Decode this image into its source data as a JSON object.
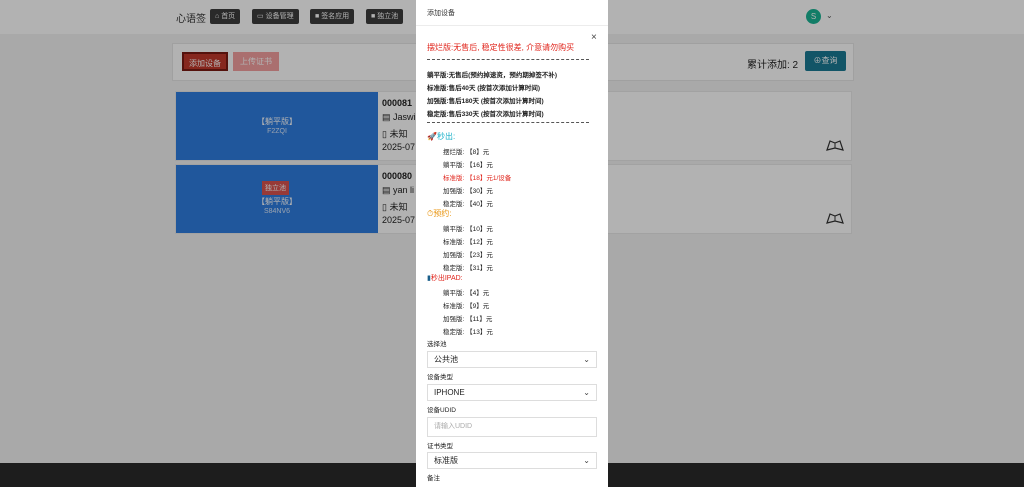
{
  "brand": "心语签",
  "nav": [
    {
      "icon": "⌂",
      "label": "首页"
    },
    {
      "icon": "▭",
      "label": "设备管理"
    },
    {
      "icon": "■",
      "label": "签名应用"
    },
    {
      "icon": "■",
      "label": "独立池"
    }
  ],
  "user": {
    "avatar": "S",
    "caret": "⌄"
  },
  "toolbar": {
    "add_label": "添加设备",
    "upload_label": "上传证书",
    "total_label": "累计添加: 2",
    "query_label": "查询",
    "query_icon": "⊕"
  },
  "cards": [
    {
      "badge": "",
      "edition": "【躺平版】",
      "code": "F2ZQI",
      "id": "000081",
      "name": "Jaswi",
      "status": "未知",
      "date": "2025-07",
      "name_icon": "▤",
      "status_icon": "▯"
    },
    {
      "badge": "独立池",
      "edition": "【躺平版】",
      "code": "S84NV6",
      "id": "000080",
      "name": "yan li",
      "status": "未知",
      "date": "2025-07",
      "name_icon": "▤",
      "status_icon": "▯"
    }
  ],
  "modal": {
    "title": "添加设备",
    "close": "×",
    "warning": "摆烂版:无售后, 稳定性很差, 介意请勿购买",
    "info_lines": [
      "躺平版:无售后(预约掉速资，预约期掉签不补)",
      "标准版:售后40天 (按首次添加计算时间)",
      "加强版:售后180天 (按首次添加计算时间)",
      "稳定版:售后330天 (按首次添加计算时间)"
    ],
    "sections": [
      {
        "icon": "🚀",
        "title": "秒出:",
        "color": "#1ab0c9",
        "items": [
          {
            "text": "摆烂版: 【8】元",
            "hl": false
          },
          {
            "text": "躺平版: 【16】元",
            "hl": false
          },
          {
            "text": "标准版: 【18】元1/设备",
            "hl": true
          },
          {
            "text": "加强版: 【30】元",
            "hl": false
          },
          {
            "text": "稳定版: 【40】元",
            "hl": false
          }
        ]
      },
      {
        "icon": "⏱",
        "title": "预约:",
        "color": "#e8930c",
        "items": [
          {
            "text": "躺平版: 【10】元",
            "hl": false
          },
          {
            "text": "标准版: 【12】元",
            "hl": false
          },
          {
            "text": "加强版: 【23】元",
            "hl": false
          },
          {
            "text": "稳定版: 【31】元",
            "hl": false
          }
        ]
      },
      {
        "icon": "▮",
        "title": "秒出IPAD:",
        "color": "#e0241b",
        "items": [
          {
            "text": "躺平版: 【4】元",
            "hl": false
          },
          {
            "text": "标准版: 【9】元",
            "hl": false
          },
          {
            "text": "加强版: 【11】元",
            "hl": false
          },
          {
            "text": "稳定版: 【13】元",
            "hl": false
          }
        ]
      }
    ],
    "form": {
      "pool_label": "选择池",
      "pool_value": "公共池",
      "device_type_label": "设备类型",
      "device_type_value": "IPHONE",
      "udid_label": "设备UDID",
      "udid_placeholder": "请输入UDID",
      "cert_label": "证书类型",
      "cert_value": "标准版",
      "note_label": "备注",
      "chevron": "⌄"
    }
  }
}
